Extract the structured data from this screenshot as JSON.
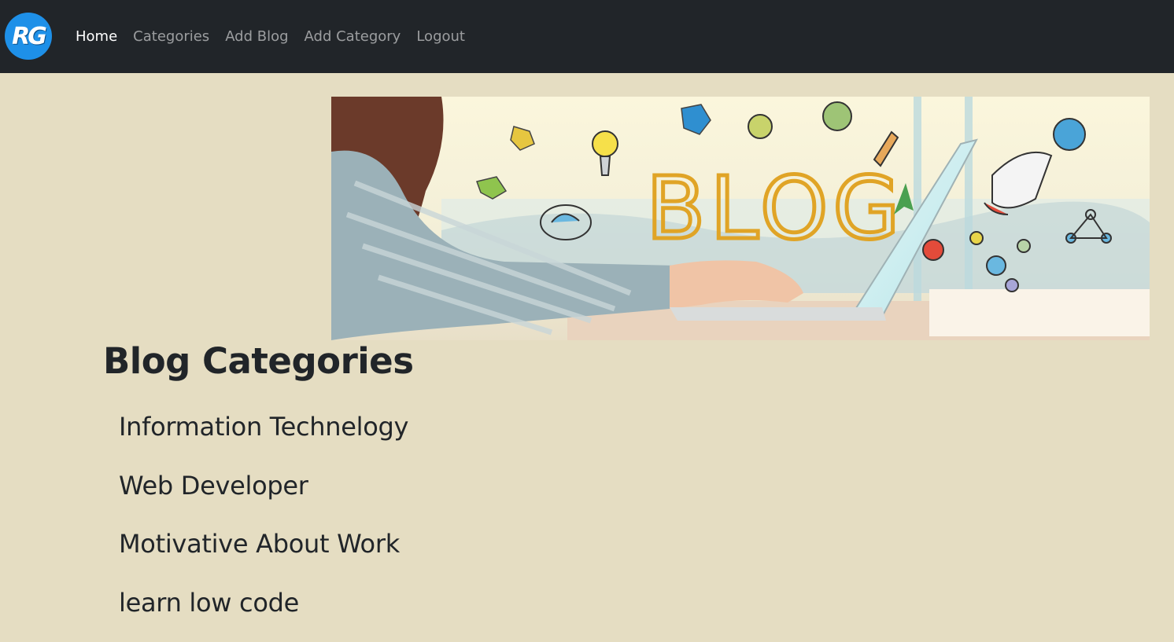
{
  "navbar": {
    "logo_text": "RG",
    "links": [
      {
        "label": "Home",
        "active": true
      },
      {
        "label": "Categories",
        "active": false
      },
      {
        "label": "Add Blog",
        "active": false
      },
      {
        "label": "Add Category",
        "active": false
      },
      {
        "label": "Logout",
        "active": false
      }
    ]
  },
  "hero": {
    "banner_text": "BLOG"
  },
  "main": {
    "title": "Blog Categories",
    "categories": [
      "Information Technelogy",
      "Web Developer",
      "Motivative About Work",
      "learn low code"
    ]
  },
  "colors": {
    "navbar_bg": "#212529",
    "page_bg": "#e5ddc2",
    "logo_blue": "#1e90e8",
    "text_dark": "#212529"
  }
}
